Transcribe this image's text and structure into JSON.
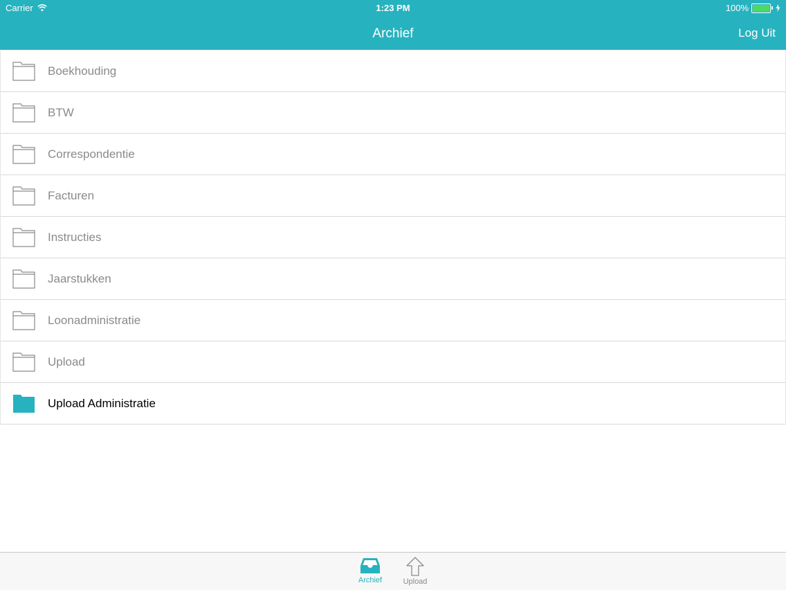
{
  "status_bar": {
    "carrier": "Carrier",
    "time": "1:23 PM",
    "battery": "100%"
  },
  "nav": {
    "title": "Archief",
    "logout_label": "Log Uit"
  },
  "folders": [
    {
      "label": "Boekhouding",
      "active": false
    },
    {
      "label": "BTW",
      "active": false
    },
    {
      "label": "Correspondentie",
      "active": false
    },
    {
      "label": "Facturen",
      "active": false
    },
    {
      "label": "Instructies",
      "active": false
    },
    {
      "label": "Jaarstukken",
      "active": false
    },
    {
      "label": "Loonadministratie",
      "active": false
    },
    {
      "label": "Upload",
      "active": false
    },
    {
      "label": "Upload Administratie",
      "active": true
    }
  ],
  "tabs": [
    {
      "label": "Archief",
      "icon": "inbox-tray-icon",
      "selected": true
    },
    {
      "label": "Upload",
      "icon": "upload-arrow-icon",
      "selected": false
    }
  ],
  "colors": {
    "accent": "#27b2bf",
    "folder_outline": "#8a8a8a",
    "battery": "#4cd964"
  }
}
